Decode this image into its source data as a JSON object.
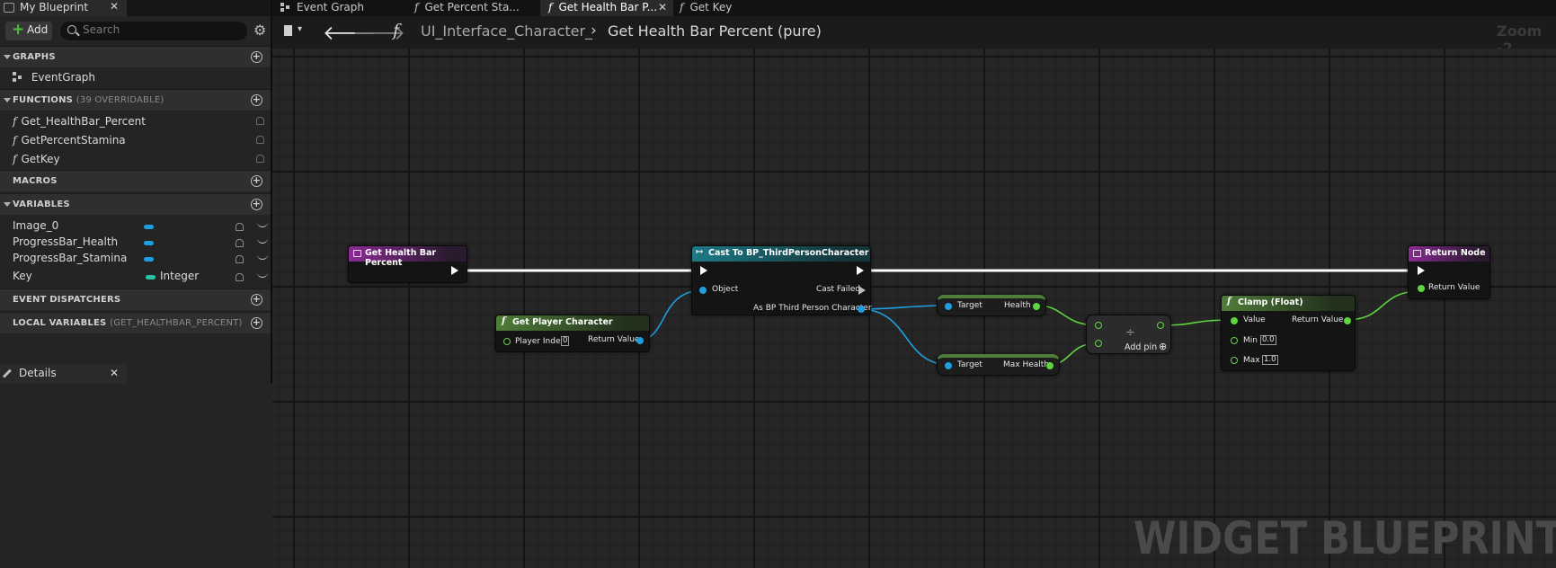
{
  "left_panel": {
    "tab_label": "My Blueprint",
    "add_label": "Add",
    "search_placeholder": "Search",
    "sections": {
      "graphs": "GRAPHS",
      "functions": "FUNCTIONS",
      "functions_count": "(39 OVERRIDABLE)",
      "macros": "MACROS",
      "variables": "VARIABLES",
      "event_dispatchers": "EVENT DISPATCHERS",
      "local_variables": "LOCAL VARIABLES",
      "local_variables_scope": "(GET_HEALTHBAR_PERCENT)"
    },
    "graphs": [
      "EventGraph"
    ],
    "functions": [
      "Get_HealthBar_Percent",
      "GetPercentStamina",
      "GetKey"
    ],
    "variables": [
      {
        "name": "Image_0",
        "type": ""
      },
      {
        "name": "ProgressBar_Health",
        "type": ""
      },
      {
        "name": "ProgressBar_Stamina",
        "type": ""
      },
      {
        "name": "Key",
        "type": "Integer"
      }
    ],
    "details_tab": "Details"
  },
  "tabs": [
    {
      "label": "Event Graph",
      "icon": "graph-icon"
    },
    {
      "label": "Get Percent Sta...",
      "icon": "function-icon"
    },
    {
      "label": "Get Health Bar P...",
      "icon": "function-icon",
      "active": true
    },
    {
      "label": "Get Key",
      "icon": "function-icon"
    }
  ],
  "toolbar": {
    "breadcrumb_root": "UI_Interface_Character_",
    "breadcrumb_current": "Get Health Bar Percent (pure)",
    "zoom": "Zoom -2"
  },
  "watermark": "WIDGET BLUEPRINT",
  "nodes": {
    "entry": {
      "title": "Get Health Bar Percent"
    },
    "cast": {
      "title": "Cast To BP_ThirdPersonCharacter",
      "pin_object": "Object",
      "pin_failed": "Cast Failed",
      "pin_as": "As BP Third Person Character"
    },
    "get_player": {
      "title": "Get Player Character",
      "pin_index": "Player Index",
      "index_value": "0",
      "pin_return": "Return Value"
    },
    "health": {
      "pin_target": "Target",
      "pin_out": "Health"
    },
    "max_health": {
      "pin_target": "Target",
      "pin_out": "Max Health"
    },
    "divide": {
      "symbol": "÷",
      "add_pin": "Add pin"
    },
    "clamp": {
      "title": "Clamp (Float)",
      "pin_value": "Value",
      "pin_min": "Min",
      "min_value": "0.0",
      "pin_max": "Max",
      "max_value": "1.0",
      "pin_return": "Return Value"
    },
    "return": {
      "title": "Return Node",
      "pin_return": "Return Value"
    }
  },
  "colors": {
    "wire_object": "#1e9ede",
    "wire_float": "#5fd63f",
    "exec": "#ffffff",
    "header_function_entry": "#8c2a95",
    "header_cast": "#1d7a86",
    "header_pure": "#4f7d3a"
  }
}
